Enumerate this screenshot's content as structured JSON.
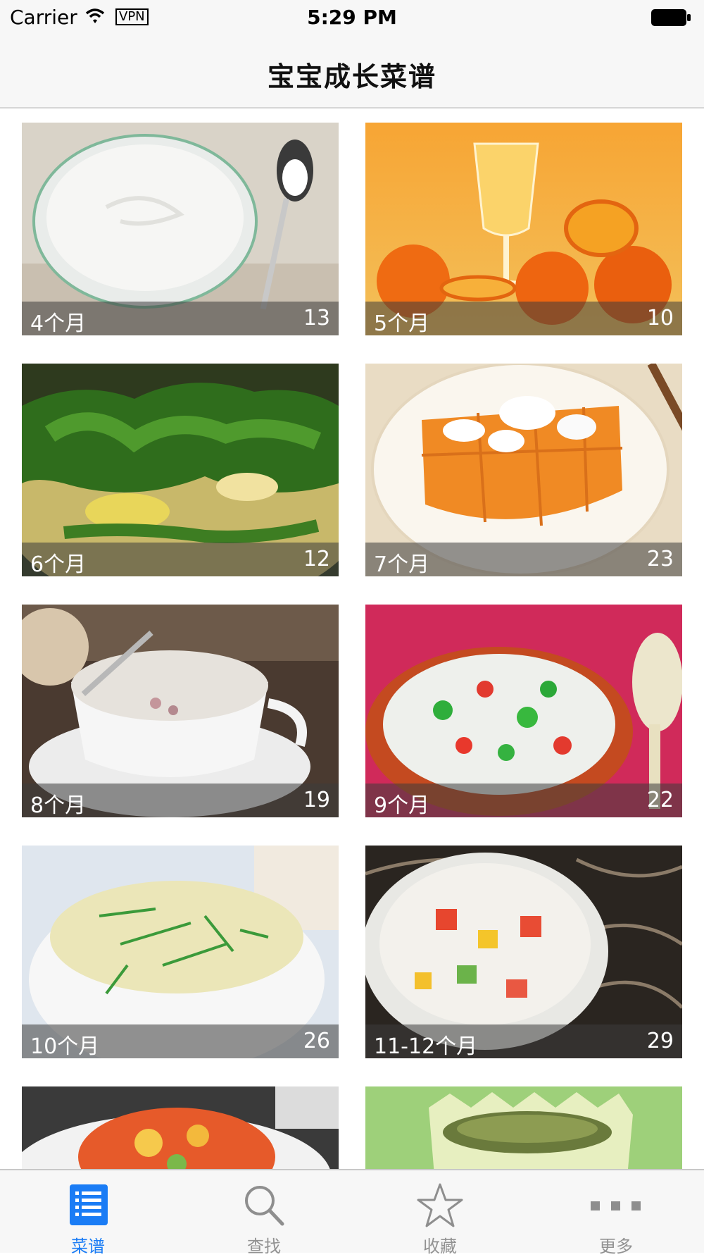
{
  "status_bar": {
    "carrier": "Carrier",
    "vpn": "VPN",
    "time": "5:29 PM"
  },
  "nav": {
    "title": "宝宝成长菜谱"
  },
  "cards": [
    {
      "label": "4个月",
      "count": "13",
      "photo": "yogurt-bowl"
    },
    {
      "label": "5个月",
      "count": "10",
      "photo": "orange-juice"
    },
    {
      "label": "6个月",
      "count": "12",
      "photo": "spinach-soup"
    },
    {
      "label": "7个月",
      "count": "23",
      "photo": "pumpkin-plate"
    },
    {
      "label": "8个月",
      "count": "19",
      "photo": "milk-soup-cup"
    },
    {
      "label": "9个月",
      "count": "22",
      "photo": "vegetable-porridge"
    },
    {
      "label": "10个月",
      "count": "26",
      "photo": "rice-porridge"
    },
    {
      "label": "11-12个月",
      "count": "29",
      "photo": "pasta-bowl"
    },
    {
      "label": "",
      "count": "",
      "photo": "tomato-egg-dish"
    },
    {
      "label": "",
      "count": "",
      "photo": "melon-bowl"
    }
  ],
  "tabs": [
    {
      "label": "菜谱",
      "icon": "list-icon",
      "active": true
    },
    {
      "label": "查找",
      "icon": "search-icon",
      "active": false
    },
    {
      "label": "收藏",
      "icon": "star-icon",
      "active": false
    },
    {
      "label": "更多",
      "icon": "more-icon",
      "active": false
    }
  ],
  "colors": {
    "accent": "#1a7cf5",
    "tab_inactive": "#929292",
    "caption_bg": "#3c3c3c"
  }
}
